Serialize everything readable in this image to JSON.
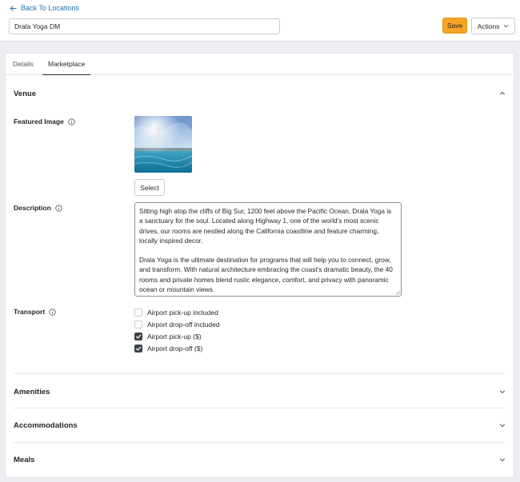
{
  "header": {
    "back_label": "Back To Locations",
    "name_value": "Drala Yoga DM",
    "save_label": "Save",
    "actions_label": "Actions"
  },
  "tabs": [
    {
      "label": "Details",
      "active": false
    },
    {
      "label": "Marketplace",
      "active": true
    }
  ],
  "venue": {
    "title": "Venue",
    "featured_image_label": "Featured Image",
    "select_label": "Select",
    "description_label": "Description",
    "description_p1": "Sitting high atop the cliffs of Big Sur, 1200 feet above the Pacific Ocean, Drala Yoga is a sanctuary for the soul. Located along Highway 1, one of the world's most scenic drives, our rooms are nestled along the California coastline and feature charming, locally inspired decor.",
    "description_p2": "Drala Yoga is the ultimate destination for programs that will help you to connect, grow, and transform. With natural architecture embracing the coast's dramatic beauty, the 40 rooms and private homes blend rustic elegance, comfort, and privacy with panoramic ocean or mountain views.",
    "transport_label": "Transport",
    "transport_options": [
      {
        "label": "Airport pick-up included",
        "checked": false
      },
      {
        "label": "Airport drop-off included",
        "checked": false
      },
      {
        "label": "Airport pick-up ($)",
        "checked": true
      },
      {
        "label": "Airport drop-off ($)",
        "checked": true
      }
    ]
  },
  "sections": [
    {
      "title": "Amenities"
    },
    {
      "title": "Accommodations"
    },
    {
      "title": "Meals"
    }
  ],
  "colors": {
    "accent_link": "#2271b1",
    "save_button": "#f5a524",
    "checkbox_checked": "#3c434a"
  }
}
